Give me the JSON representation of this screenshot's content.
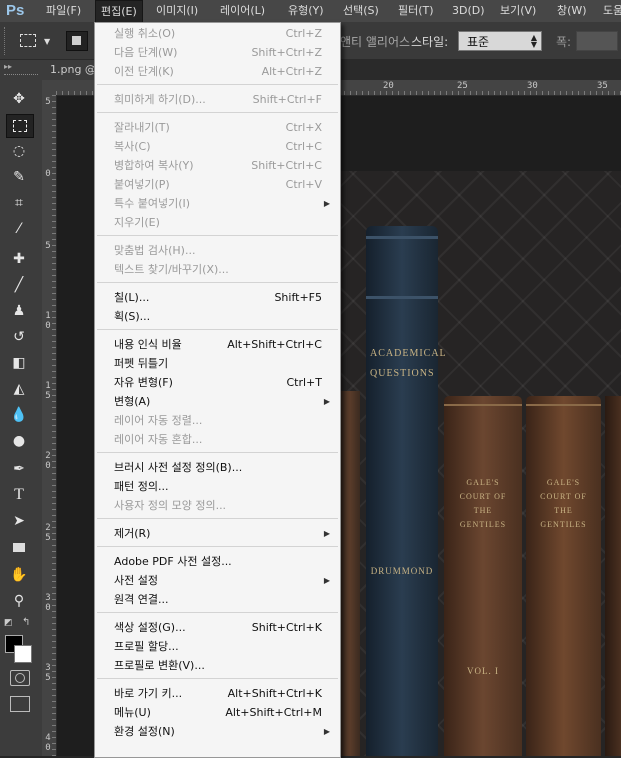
{
  "app": {
    "logo": "Ps"
  },
  "menubar": {
    "items": [
      {
        "label": "파일(F)"
      },
      {
        "label": "편집(E)"
      },
      {
        "label": "이미지(I)"
      },
      {
        "label": "레이어(L)"
      },
      {
        "label": "유형(Y)"
      },
      {
        "label": "선택(S)"
      },
      {
        "label": "필터(T)"
      },
      {
        "label": "3D(D)"
      },
      {
        "label": "보기(V)"
      },
      {
        "label": "창(W)"
      },
      {
        "label": "도움"
      }
    ]
  },
  "options": {
    "antialias_label": "앤티 앨리어스",
    "style_label": "스타일:",
    "style_value": "표준",
    "width_label": "폭:"
  },
  "document": {
    "tab": "1.png @"
  },
  "rulers": {
    "top": [
      "20",
      "25",
      "30",
      "35"
    ],
    "left": [
      "5",
      "0",
      "5",
      "1 0",
      "1 5",
      "2 0",
      "2 5",
      "3 0",
      "3 5",
      "4 0"
    ]
  },
  "artwork": {
    "spine1": "ACADEMICAL QUESTIONS",
    "spine1_author": "DRUMMOND",
    "spine2": "GALE'S COURT OF THE GENTILES",
    "spine3": "GALE'S COURT OF THE GENTILES",
    "vol": "VOL. I"
  },
  "edit_menu": {
    "g1": [
      {
        "label": "실행 취소(O)",
        "shortcut": "Ctrl+Z"
      },
      {
        "label": "다음 단계(W)",
        "shortcut": "Shift+Ctrl+Z"
      },
      {
        "label": "이전 단계(K)",
        "shortcut": "Alt+Ctrl+Z"
      }
    ],
    "g2": [
      {
        "label": "희미하게 하기(D)...",
        "shortcut": "Shift+Ctrl+F"
      }
    ],
    "g3": [
      {
        "label": "잘라내기(T)",
        "shortcut": "Ctrl+X"
      },
      {
        "label": "복사(C)",
        "shortcut": "Ctrl+C"
      },
      {
        "label": "병합하여 복사(Y)",
        "shortcut": "Shift+Ctrl+C"
      },
      {
        "label": "붙여넣기(P)",
        "shortcut": "Ctrl+V"
      },
      {
        "label": "특수 붙여넣기(I)",
        "shortcut": ""
      },
      {
        "label": "지우기(E)",
        "shortcut": ""
      }
    ],
    "g4": [
      {
        "label": "맞춤법 검사(H)...",
        "shortcut": ""
      },
      {
        "label": "텍스트 찾기/바꾸기(X)...",
        "shortcut": ""
      }
    ],
    "g5": [
      {
        "label": "칠(L)...",
        "shortcut": "Shift+F5"
      },
      {
        "label": "획(S)...",
        "shortcut": ""
      }
    ],
    "g6": [
      {
        "label": "내용 인식 비율",
        "shortcut": "Alt+Shift+Ctrl+C"
      },
      {
        "label": "퍼펫 뒤틀기",
        "shortcut": ""
      },
      {
        "label": "자유 변형(F)",
        "shortcut": "Ctrl+T"
      },
      {
        "label": "변형(A)",
        "shortcut": ""
      },
      {
        "label": "레이어 자동 정렬...",
        "shortcut": ""
      },
      {
        "label": "레이어 자동 혼합...",
        "shortcut": ""
      }
    ],
    "g7": [
      {
        "label": "브러시 사전 설정 정의(B)...",
        "shortcut": ""
      },
      {
        "label": "패턴 정의...",
        "shortcut": ""
      },
      {
        "label": "사용자 정의 모양 정의...",
        "shortcut": ""
      }
    ],
    "g8": [
      {
        "label": "제거(R)",
        "shortcut": ""
      }
    ],
    "g9": [
      {
        "label": "Adobe PDF 사전 설정...",
        "shortcut": ""
      },
      {
        "label": "사전 설정",
        "shortcut": ""
      },
      {
        "label": "원격 연결...",
        "shortcut": ""
      }
    ],
    "g10": [
      {
        "label": "색상 설정(G)...",
        "shortcut": "Shift+Ctrl+K"
      },
      {
        "label": "프로필 할당...",
        "shortcut": ""
      },
      {
        "label": "프로필로 변환(V)...",
        "shortcut": ""
      }
    ],
    "g11": [
      {
        "label": "바로 가기 키...",
        "shortcut": "Alt+Shift+Ctrl+K"
      },
      {
        "label": "메뉴(U)",
        "shortcut": "Alt+Shift+Ctrl+M"
      },
      {
        "label": "환경 설정(N)",
        "shortcut": ""
      }
    ]
  },
  "tools": [
    "move-tool-icon",
    "marquee-tool-icon",
    "lasso-tool-icon",
    "quick-select-tool-icon",
    "crop-tool-icon",
    "eyedropper-tool-icon",
    "healing-brush-tool-icon",
    "brush-tool-icon",
    "stamp-tool-icon",
    "history-brush-tool-icon",
    "eraser-tool-icon",
    "paint-bucket-tool-icon",
    "blur-tool-icon",
    "dodge-tool-icon",
    "pen-tool-icon",
    "type-tool-icon",
    "path-select-tool-icon",
    "shape-tool-icon",
    "hand-tool-icon",
    "zoom-tool-icon"
  ],
  "colors": {
    "menu_bg": "#f5f5f5",
    "chrome": "#3c3c3c",
    "active_menu": "#242424"
  }
}
